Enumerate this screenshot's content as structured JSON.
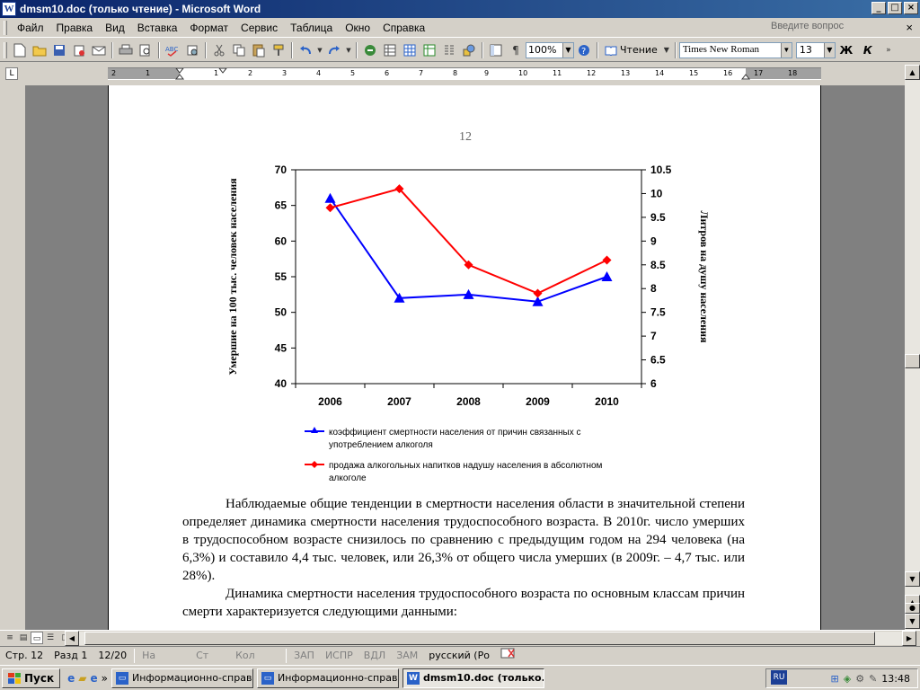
{
  "window": {
    "title": "dmsm10.doc (только чтение) - Microsoft Word",
    "app_icon_letter": "W",
    "minimize": "_",
    "maximize": "□",
    "close": "×"
  },
  "menu": {
    "items": [
      "Файл",
      "Правка",
      "Вид",
      "Вставка",
      "Формат",
      "Сервис",
      "Таблица",
      "Окно",
      "Справка"
    ],
    "ask_placeholder": "Введите вопрос",
    "close_doc": "×"
  },
  "toolbar": {
    "zoom": "100%",
    "read_label": "Чтение",
    "font_name": "Times New Roman",
    "font_size": "13",
    "bold": "Ж",
    "italic": "К"
  },
  "ruler": {
    "corner": "L",
    "ticks": [
      "2",
      "1",
      "1",
      "2",
      "3",
      "4",
      "5",
      "6",
      "7",
      "8",
      "9",
      "10",
      "11",
      "12",
      "13",
      "14",
      "15",
      "16",
      "17",
      "18"
    ]
  },
  "page": {
    "page_number": "12",
    "paragraph1": "Наблюдаемые общие тенденции в смертности населения области в значительной степени определяет динамика смертности населения трудоспособного возраста. В 2010г. число умерших в трудоспособном возрасте снизилось по сравнению с предыдущим годом на 294 человека (на 6,3%) и составило 4,4 тыс. человек, или 26,3% от общего числа умерших (в 2009г. – 4,7 тыс. или 28%).",
    "paragraph2": "Динамика смертности населения трудоспособного возраста по основным классам причин смерти характеризуется следующими данными:"
  },
  "chart_data": {
    "type": "line",
    "categories": [
      "2006",
      "2007",
      "2008",
      "2009",
      "2010"
    ],
    "ylabel": "Умершие на 100 тыс. человек населения",
    "y2label": "Литров на душу населения",
    "ylim": [
      40,
      70
    ],
    "yticks": [
      "70",
      "65",
      "60",
      "55",
      "50",
      "45",
      "40"
    ],
    "y2lim": [
      6,
      10.5
    ],
    "y2ticks": [
      "10.5",
      "10",
      "9.5",
      "9",
      "8.5",
      "8",
      "7.5",
      "7",
      "6.5",
      "6"
    ],
    "series": [
      {
        "name": "коэффициент смертности населения от причин связанных с употреблением алкоголя",
        "axis": "left",
        "values": [
          66,
          52,
          52.5,
          51.5,
          55
        ],
        "color": "#0000ff",
        "marker": "triangle"
      },
      {
        "name": "продажа алкогольных напитков надушу населения в абсолютном алкоголе",
        "axis": "right",
        "values": [
          9.7,
          10.1,
          8.5,
          7.9,
          8.6
        ],
        "color": "#ff0000",
        "marker": "diamond"
      }
    ],
    "legend_position": "bottom",
    "legend_lines": [
      [
        "коэффициент смертности населения от причин связанных с",
        "употреблением алкоголя"
      ],
      [
        "продажа алкогольных напитков надушу населения в абсолютном",
        "алкоголе"
      ]
    ]
  },
  "status": {
    "page": "Стр. 12",
    "section": "Разд 1",
    "pages": "12/20",
    "at": "На",
    "line": "Ст",
    "col": "Кол",
    "rec": "ЗАП",
    "trk": "ИСПР",
    "ext": "ВДЛ",
    "ovr": "ЗАМ",
    "language": "русский (Ро"
  },
  "taskbar": {
    "start": "Пуск",
    "chevron": "»",
    "tasks": [
      {
        "label": "Информационно-справо...",
        "active": false
      },
      {
        "label": "Информационно-справо...",
        "active": false
      },
      {
        "label": "dmsm10.doc (только...",
        "active": true
      }
    ],
    "lang": "RU",
    "clock": "13:48"
  }
}
